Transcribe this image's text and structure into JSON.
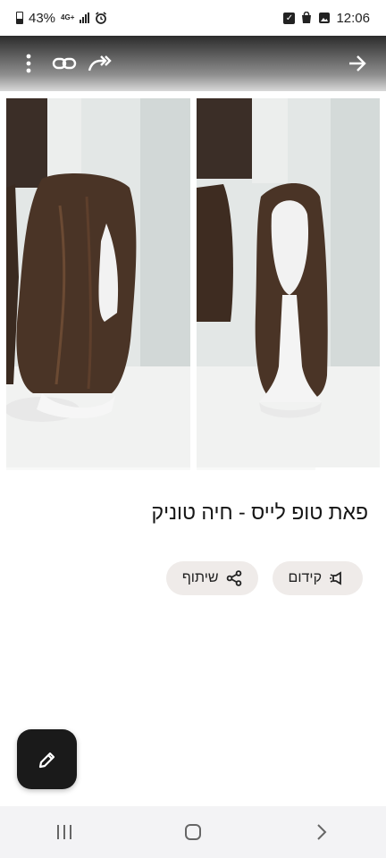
{
  "status_bar": {
    "battery": "43%",
    "network": "4G+",
    "time": "12:06",
    "left_icons": [
      "battery-icon",
      "network-icon",
      "signal-icon",
      "alarm-icon"
    ],
    "right_icons": [
      "check-square-icon",
      "bag-icon",
      "image-icon"
    ]
  },
  "top_bar": {
    "icons": [
      "more-vertical-icon",
      "link-icon",
      "share-forward-icon",
      "arrow-forward-icon"
    ]
  },
  "gallery": {
    "image_count": 2,
    "progress_fraction": 0.35
  },
  "listing": {
    "title": "פאת טופ לייס - חיה טוניק"
  },
  "actions": {
    "promote_label": "קידום",
    "share_label": "שיתוף"
  },
  "fab": {
    "icon": "pencil-icon"
  },
  "nav_bar": {
    "icons": [
      "recents-icon",
      "home-icon",
      "back-icon"
    ]
  },
  "colors": {
    "chip_bg": "#efebe9",
    "fab_bg": "#1a1a1a",
    "nav_bg": "#f3f3f5"
  }
}
